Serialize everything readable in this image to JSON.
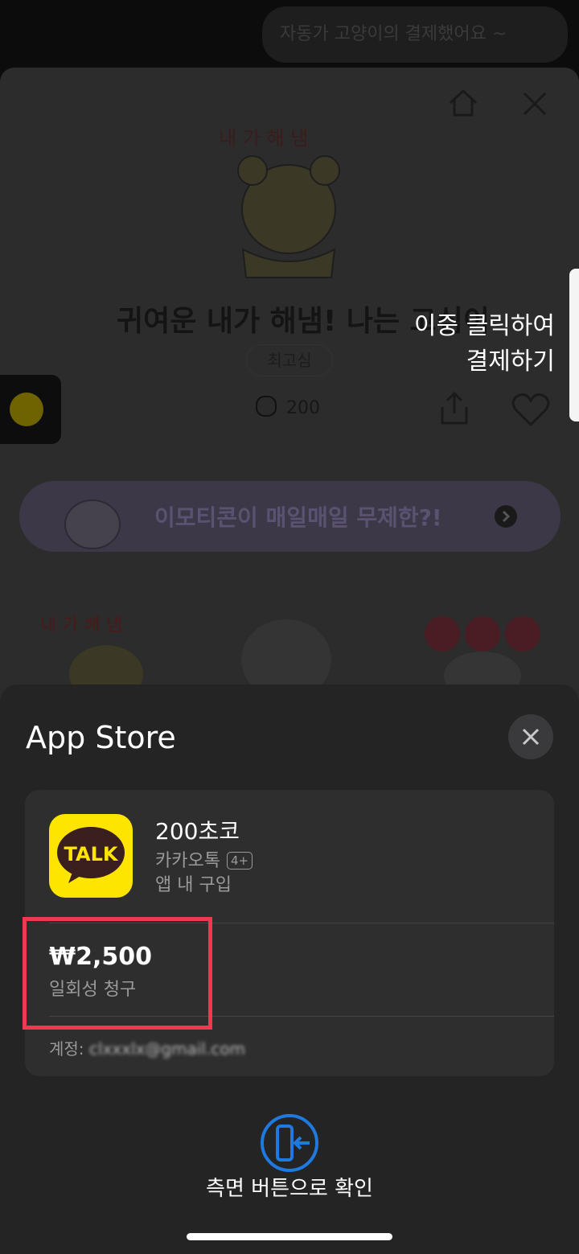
{
  "toast": {
    "text": "자동가 고양이의 결제했어요 ~"
  },
  "store": {
    "emoticon_title": "귀여운 내가 해냄! 나는 고심이",
    "tag": "최고심",
    "price": "200",
    "promo_banner": "이모티콘이 매일매일 무제한?!"
  },
  "overlay_hint": {
    "line1": "이중 클릭하여",
    "line2": "결제하기"
  },
  "appstore": {
    "title": "App Store",
    "product_name": "200초코",
    "app_name": "카카오톡",
    "age_rating": "4+",
    "purchase_type": "앱 내 구입",
    "price": "₩2,500",
    "billing_note": "일회성 청구",
    "account_label": "계정:",
    "account_email": "clxxxlx@gmail.com",
    "confirm_text": "측면 버튼으로 확인",
    "app_icon_text": "TALK"
  },
  "colors": {
    "highlight": "#f0394f",
    "kakao_yellow": "#fee500",
    "confirm_blue": "#1f7ae0"
  }
}
